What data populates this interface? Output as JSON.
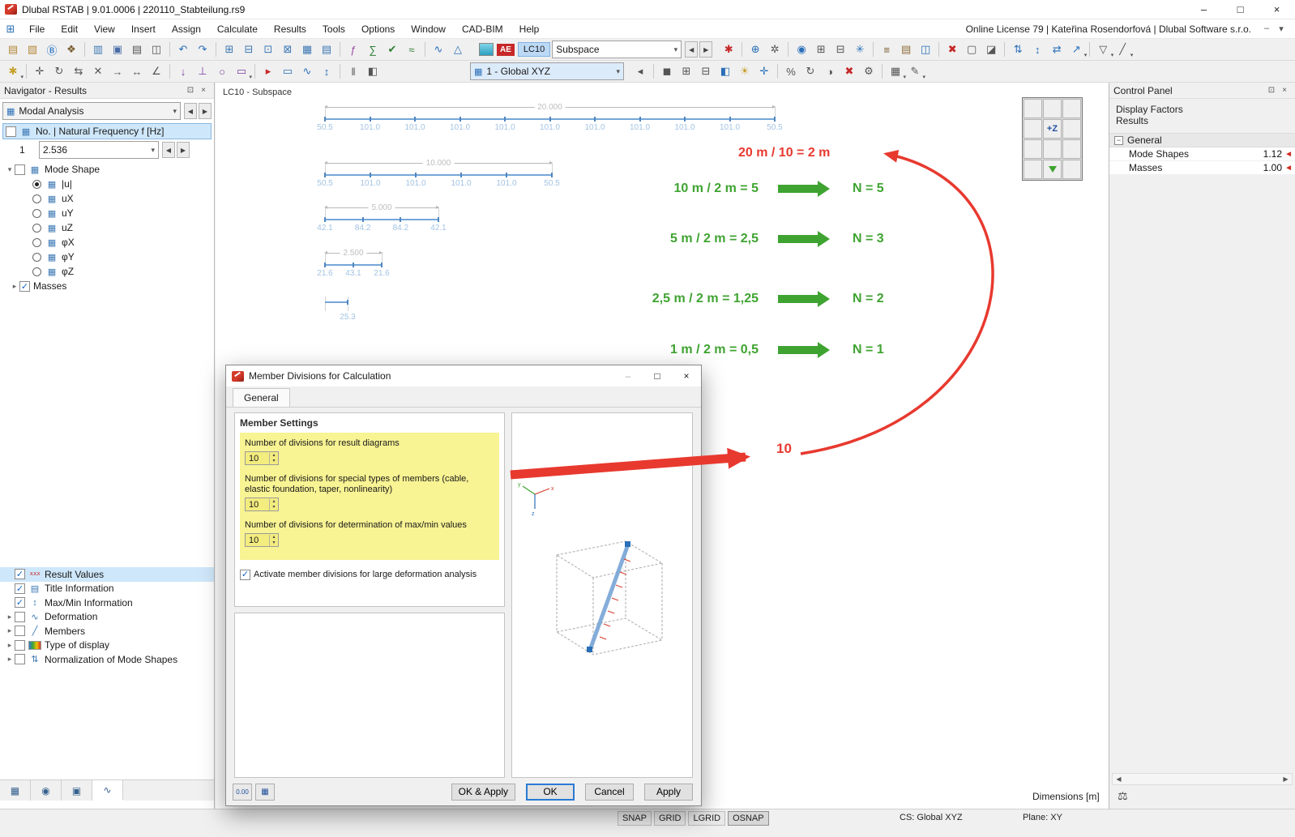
{
  "titlebar": {
    "title": "Dlubal RSTAB | 9.01.0006 | 220110_Stabteilung.rs9"
  },
  "menubar": {
    "items": [
      "File",
      "Edit",
      "View",
      "Insert",
      "Assign",
      "Calculate",
      "Results",
      "Tools",
      "Options",
      "Window",
      "CAD-BIM",
      "Help"
    ],
    "license": "Online License 79 | Kateřina Rosendorfová | Dlubal Software s.r.o."
  },
  "toolbar1": {
    "left_icons": [
      {
        "name": "new-model-icon",
        "g": "▤",
        "c": "#b5883c"
      },
      {
        "name": "open-model-icon",
        "g": "▧",
        "c": "#b5883c"
      },
      {
        "name": "dlubal-bim-icon",
        "g": "Ⓑ",
        "c": "#1565c0"
      },
      {
        "name": "block-manager-icon",
        "g": "❖",
        "c": "#7a5c2e"
      },
      {
        "sep": true
      },
      {
        "name": "navigator-toggle-icon",
        "g": "▥",
        "c": "#3c78b4"
      },
      {
        "name": "save-icon",
        "g": "▣",
        "c": "#4a6da7"
      },
      {
        "name": "print-icon",
        "g": "▤",
        "c": "#555555"
      },
      {
        "name": "copy-image-icon",
        "g": "◫",
        "c": "#555555"
      },
      {
        "sep": true
      },
      {
        "name": "undo-icon",
        "g": "↶",
        "c": "#2a6fb8"
      },
      {
        "name": "redo-icon",
        "g": "↷",
        "c": "#2a6fb8"
      },
      {
        "sep": true
      },
      {
        "name": "table-layout-icon",
        "g": "⊞",
        "c": "#3c78b4"
      },
      {
        "name": "table-view-icon",
        "g": "⊟",
        "c": "#3c78b4"
      },
      {
        "name": "table-goto-icon",
        "g": "⊡",
        "c": "#3c78b4"
      },
      {
        "name": "table-export-icon",
        "g": "⊠",
        "c": "#3c78b4"
      },
      {
        "name": "table-ocr-icon",
        "g": "▦",
        "c": "#3c78b4"
      },
      {
        "name": "table-settings-icon",
        "g": "▤",
        "c": "#3c78b4"
      },
      {
        "sep": true
      },
      {
        "name": "generate-loads-icon",
        "g": "ƒ",
        "c": "#9a4ba0"
      },
      {
        "name": "calculate-all-icon",
        "g": "∑",
        "c": "#2e7d32"
      },
      {
        "name": "plausibility-check-icon",
        "g": "✔",
        "c": "#2e7d32"
      },
      {
        "name": "calculation-params-icon",
        "g": "≈",
        "c": "#2e7d32"
      },
      {
        "sep": true
      },
      {
        "name": "results-diagram-icon",
        "g": "∿",
        "c": "#2a6fb8"
      },
      {
        "name": "results-table-icon",
        "g": "△",
        "c": "#2a6fb8"
      }
    ],
    "case_group": {
      "badge": "AE",
      "lc": "LC10",
      "combo": "Subspace"
    },
    "right_icons": [
      {
        "name": "favorites-icon",
        "g": "✱",
        "c": "#c62828"
      },
      {
        "sep": true
      },
      {
        "name": "snap-values-icon",
        "g": "⊕",
        "c": "#2a6fb8"
      },
      {
        "name": "result-values-icon",
        "g": "✲",
        "c": "#555555"
      },
      {
        "sep": true
      },
      {
        "name": "show-results-icon",
        "g": "◉",
        "c": "#2a6fb8"
      },
      {
        "name": "zoom-window-icon",
        "g": "⊞",
        "c": "#555555"
      },
      {
        "name": "zoom-values-icon",
        "g": "⊟",
        "c": "#555555"
      },
      {
        "name": "max-values-icon",
        "g": "✳",
        "c": "#2a6fb8"
      },
      {
        "sep": true
      },
      {
        "name": "layers-icon",
        "g": "≡",
        "c": "#7a5c2e"
      },
      {
        "name": "printout-report-icon",
        "g": "▤",
        "c": "#8e6d3a"
      },
      {
        "name": "visibility-icon",
        "g": "◫",
        "c": "#2a6fb8"
      },
      {
        "sep": true
      },
      {
        "name": "delete-results-icon",
        "g": "✖",
        "c": "#c62828"
      },
      {
        "name": "isometric-view-icon",
        "g": "▢",
        "c": "#555555"
      },
      {
        "name": "render-model-icon",
        "g": "◪",
        "c": "#555555"
      },
      {
        "sep": true
      },
      {
        "name": "member-insert-icon",
        "g": "⇅",
        "c": "#2a6fb8"
      },
      {
        "name": "member-divide-icon",
        "g": "↕",
        "c": "#2a6fb8"
      },
      {
        "name": "member-connect-icon",
        "g": "⇄",
        "c": "#2a6fb8"
      },
      {
        "name": "member-extend-icon",
        "g": "↗",
        "c": "#2a6fb8",
        "dd": true
      },
      {
        "sep": true
      },
      {
        "name": "filter-icon",
        "g": "▽",
        "c": "#555555",
        "dd": true
      },
      {
        "name": "line-style-icon",
        "g": "╱",
        "c": "#555555",
        "dd": true
      }
    ]
  },
  "toolbar2": {
    "left_icons": [
      {
        "name": "select-special-icon",
        "g": "✱",
        "c": "#c6a02c",
        "dd": true
      },
      {
        "sep": true
      },
      {
        "name": "edit-move-icon",
        "g": "✛",
        "c": "#555555"
      },
      {
        "name": "edit-rotate-icon",
        "g": "↻",
        "c": "#555555"
      },
      {
        "name": "edit-mirror-icon",
        "g": "⇆",
        "c": "#555555"
      },
      {
        "name": "edit-divide-icon",
        "g": "✕",
        "c": "#555555"
      },
      {
        "name": "edit-extend-icon",
        "g": "→",
        "c": "#555555"
      },
      {
        "name": "edit-dimension-icon",
        "g": "↔",
        "c": "#555555"
      },
      {
        "name": "edit-angle-icon",
        "g": "∠",
        "c": "#555555"
      },
      {
        "sep": true
      },
      {
        "name": "load-node-icon",
        "g": "↓",
        "c": "#7a3ca0"
      },
      {
        "name": "support-icon",
        "g": "⊥",
        "c": "#7a3ca0"
      },
      {
        "name": "hinge-icon",
        "g": "○",
        "c": "#7a3ca0"
      },
      {
        "name": "eccentricity-icon",
        "g": "▭",
        "c": "#7a3ca0",
        "dd": true
      },
      {
        "sep": true
      },
      {
        "name": "guide-object-icon",
        "g": "▸",
        "c": "#c62828"
      },
      {
        "name": "frame-window-icon",
        "g": "▭",
        "c": "#2a6fb8"
      },
      {
        "name": "mode-shape-icon",
        "g": "∿",
        "c": "#2a6fb8"
      },
      {
        "name": "animate-icon",
        "g": "↕",
        "c": "#2a6fb8"
      },
      {
        "sep": true
      },
      {
        "name": "two-sections-icon",
        "g": "‖",
        "c": "#555555"
      },
      {
        "name": "section-view-icon",
        "g": "◧",
        "c": "#555555"
      }
    ],
    "view_combo": "1 - Global XYZ",
    "right_icons": [
      {
        "name": "view-prev-icon",
        "g": "◂",
        "c": "#555555"
      },
      {
        "sep": true
      },
      {
        "name": "render-solid-icon",
        "g": "◼",
        "c": "#555555"
      },
      {
        "name": "grid-points-icon",
        "g": "⊞",
        "c": "#555555"
      },
      {
        "name": "grid-lines-icon",
        "g": "⊟",
        "c": "#555555"
      },
      {
        "name": "shading-icon",
        "g": "◧",
        "c": "#2a6fb8"
      },
      {
        "name": "light-icon",
        "g": "☀",
        "c": "#c6a02c"
      },
      {
        "name": "axes-icon",
        "g": "✛",
        "c": "#2a6fb8"
      },
      {
        "sep": true
      },
      {
        "name": "percent-icon",
        "g": "%",
        "c": "#555555"
      },
      {
        "name": "sync-views-icon",
        "g": "↻",
        "c": "#555555"
      },
      {
        "name": "mirror-view-icon",
        "g": "◑",
        "c": "#555555"
      },
      {
        "name": "delete-view-icon",
        "g": "✖",
        "c": "#c62828"
      },
      {
        "name": "view-settings-icon",
        "g": "⚙",
        "c": "#555555"
      },
      {
        "sep": true
      },
      {
        "name": "display-props-icon",
        "g": "▦",
        "c": "#555555",
        "dd": true
      },
      {
        "name": "pen-icon",
        "g": "✎",
        "c": "#555555",
        "dd": true
      }
    ]
  },
  "navigator": {
    "title": "Navigator - Results",
    "analysis_combo": "Modal Analysis",
    "freq_header": "No. | Natural Frequency f [Hz]",
    "freq_no": "1",
    "freq_value": "2.536",
    "mode_shape_label": "Mode Shape",
    "mode_options": [
      {
        "label": "|u|",
        "selected": true
      },
      {
        "label": "uX"
      },
      {
        "label": "uY"
      },
      {
        "label": "uZ"
      },
      {
        "label": "φX"
      },
      {
        "label": "φY"
      },
      {
        "label": "φZ"
      }
    ],
    "masses_label": "Masses",
    "bottom_items": [
      {
        "label": "Result Values",
        "checked": true,
        "selected": true,
        "icon": "x.x.x"
      },
      {
        "label": "Title Information",
        "checked": true,
        "icon": "▤"
      },
      {
        "label": "Max/Min Information",
        "checked": true,
        "icon": "↕"
      },
      {
        "label": "Deformation",
        "checked": false,
        "expand": true,
        "icon": "∿"
      },
      {
        "label": "Members",
        "checked": false,
        "expand": true,
        "icon": "╱"
      },
      {
        "label": "Type of display",
        "checked": false,
        "expand": true,
        "icon": "grad"
      },
      {
        "label": "Normalization of Mode Shapes",
        "checked": false,
        "expand": true,
        "icon": "⇅"
      }
    ],
    "tabs": [
      {
        "name": "nav-tab-data",
        "glyph": "▦"
      },
      {
        "name": "nav-tab-display",
        "glyph": "◉"
      },
      {
        "name": "nav-tab-views",
        "glyph": "▣"
      },
      {
        "name": "nav-tab-results",
        "glyph": "∿",
        "active": true
      }
    ]
  },
  "canvas": {
    "view_label": "LC10 - Subspace",
    "red_formula": "20 m / 10 = 2 m",
    "red_value": "10",
    "keypad_label": "+Z",
    "dimensions_label": "Dimensions [m]",
    "annotation_rows": [
      {
        "formula": "10 m / 2 m = 5",
        "result": "N = 5"
      },
      {
        "formula": "5 m / 2 m = 2,5",
        "result": "N = 3"
      },
      {
        "formula": "2,5 m / 2 m = 1,25",
        "result": "N = 2"
      },
      {
        "formula": "1 m / 2 m = 0,5",
        "result": "N = 1"
      }
    ],
    "beams": [
      {
        "dim": "20.000",
        "values": [
          "50.5",
          "101.0",
          "101.0",
          "101.0",
          "101.0",
          "101.0",
          "101.0",
          "101.0",
          "101.0",
          "101.0",
          "50.5"
        ]
      },
      {
        "dim": "10.000",
        "values": [
          "50.5",
          "101.0",
          "101.0",
          "101.0",
          "101.0",
          "50.5"
        ]
      },
      {
        "dim": "5.000",
        "values": [
          "42.1",
          "84.2",
          "84.2",
          "42.1"
        ]
      },
      {
        "dim": "2.500",
        "values": [
          "21.6",
          "43.1",
          "21.6"
        ]
      },
      {
        "dim": "",
        "values": [
          "25.3"
        ]
      }
    ]
  },
  "dialog": {
    "title": "Member Divisions for Calculation",
    "tab": "General",
    "section": "Member Settings",
    "fields": [
      {
        "label": "Number of divisions for result diagrams",
        "value": "10"
      },
      {
        "label": "Number of divisions for special types of members (cable, elastic foundation, taper, nonlinearity)",
        "value": "10"
      },
      {
        "label": "Number of divisions for determination of max/min values",
        "value": "10"
      }
    ],
    "checkbox_label": "Activate member divisions for large deformation analysis",
    "checkbox_checked": true,
    "buttons": [
      "OK & Apply",
      "OK",
      "Cancel",
      "Apply"
    ],
    "default_button": "OK"
  },
  "control_panel": {
    "title": "Control Panel",
    "line1": "Display Factors",
    "line2": "Results",
    "group": "General",
    "items": [
      {
        "label": "Mode Shapes",
        "value": "1.12"
      },
      {
        "label": "Masses",
        "value": "1.00"
      }
    ]
  },
  "statusbar": {
    "toggles": [
      {
        "label": "SNAP"
      },
      {
        "label": "GRID"
      },
      {
        "label": "LGRID"
      },
      {
        "label": "OSNAP",
        "pressed": true
      }
    ],
    "cs": "CS: Global XYZ",
    "plane": "Plane: XY"
  },
  "colors": {
    "accent_red": "#e8392f",
    "accent_green": "#3fa331",
    "selection_blue": "#cfe7fa",
    "highlight_yellow": "#f8f393",
    "beam_blue": "#74a6d8"
  }
}
